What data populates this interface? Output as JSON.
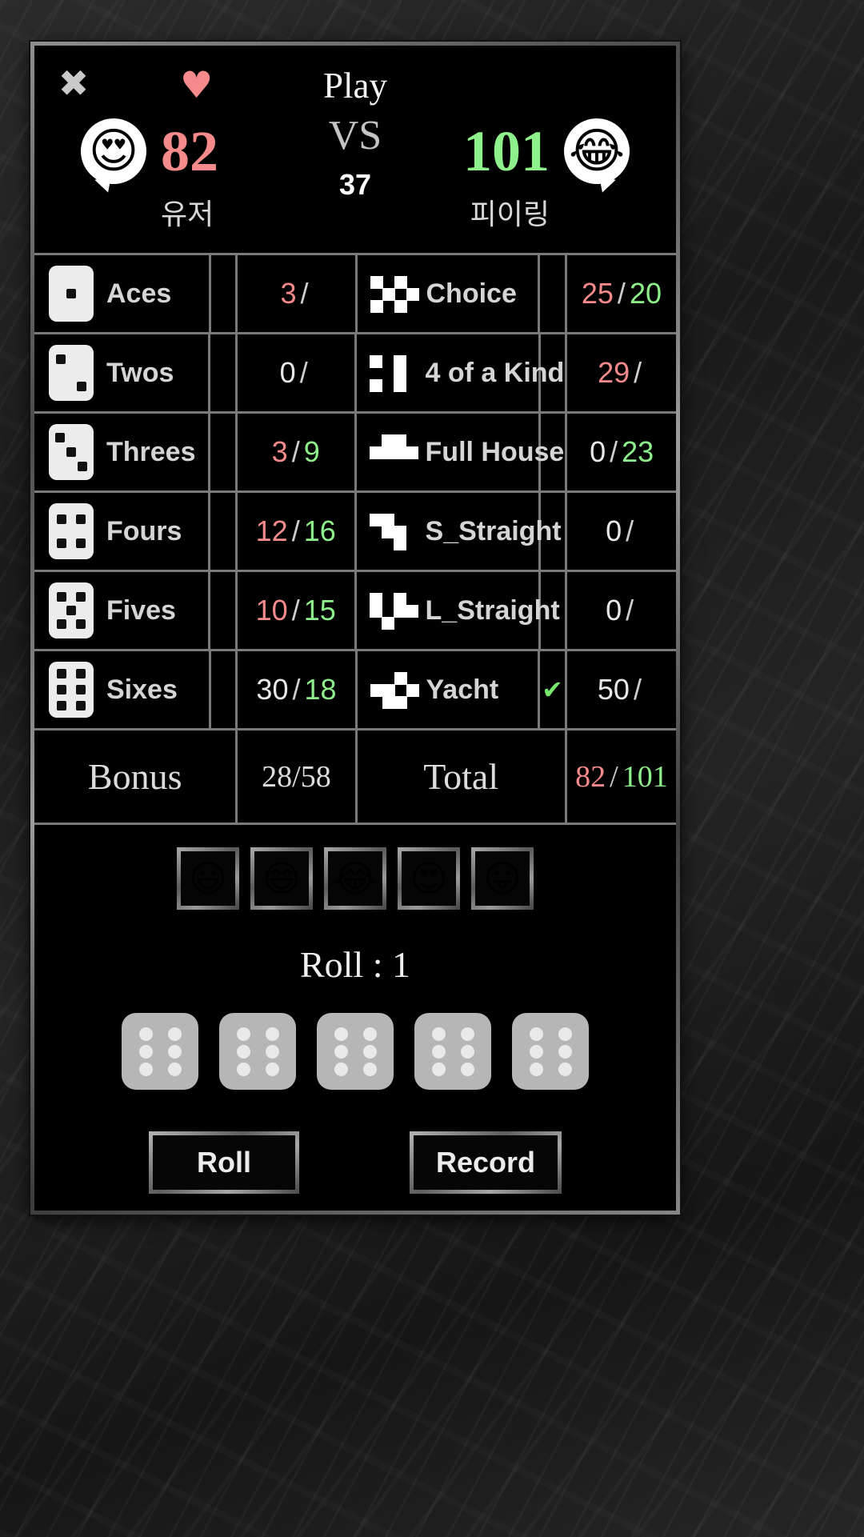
{
  "header": {
    "close_icon": "✖",
    "turn_heart_icon": "♥",
    "play_label": "Play",
    "vs_label": "VS",
    "turn_count": "37",
    "left_player": {
      "avatar_emoji": "😍",
      "score": "82",
      "name": "유저",
      "color": "#f58a8a"
    },
    "right_player": {
      "avatar_emoji": "😂",
      "score": "101",
      "name": "피이링",
      "color": "#8ef08a"
    }
  },
  "table": {
    "rows": [
      {
        "left": {
          "label": "Aces",
          "icon": "die-1",
          "score_a": "3",
          "score_b": "",
          "a_color": "red",
          "b_color": "green",
          "checked": false
        },
        "right": {
          "label": "Choice",
          "icon": "pix-choice",
          "score_a": "25",
          "score_b": "20",
          "a_color": "red",
          "b_color": "green",
          "checked": false
        }
      },
      {
        "left": {
          "label": "Twos",
          "icon": "die-2",
          "score_a": "0",
          "score_b": "",
          "a_color": "white",
          "b_color": "green",
          "checked": false
        },
        "right": {
          "label": "4 of a Kind",
          "icon": "pix-four",
          "score_a": "29",
          "score_b": "",
          "a_color": "red",
          "b_color": "green",
          "checked": false
        }
      },
      {
        "left": {
          "label": "Threes",
          "icon": "die-3",
          "score_a": "3",
          "score_b": "9",
          "a_color": "red",
          "b_color": "green",
          "checked": false
        },
        "right": {
          "label": "Full House",
          "icon": "pix-fullhouse",
          "score_a": "0",
          "score_b": "23",
          "a_color": "white",
          "b_color": "green",
          "checked": false
        }
      },
      {
        "left": {
          "label": "Fours",
          "icon": "die-4",
          "score_a": "12",
          "score_b": "16",
          "a_color": "red",
          "b_color": "green",
          "checked": false
        },
        "right": {
          "label": "S_Straight",
          "icon": "pix-sstraight",
          "score_a": "0",
          "score_b": "",
          "a_color": "white",
          "b_color": "green",
          "checked": false
        }
      },
      {
        "left": {
          "label": "Fives",
          "icon": "die-5",
          "score_a": "10",
          "score_b": "15",
          "a_color": "red",
          "b_color": "green",
          "checked": false
        },
        "right": {
          "label": "L_Straight",
          "icon": "pix-lstraight",
          "score_a": "0",
          "score_b": "",
          "a_color": "white",
          "b_color": "green",
          "checked": false
        }
      },
      {
        "left": {
          "label": "Sixes",
          "icon": "die-6",
          "score_a": "30",
          "score_b": "18",
          "a_color": "white",
          "b_color": "green",
          "checked": false
        },
        "right": {
          "label": "Yacht",
          "icon": "pix-yacht",
          "score_a": "50",
          "score_b": "",
          "a_color": "white",
          "b_color": "green",
          "checked": true,
          "check_icon": "✔"
        }
      }
    ],
    "bonus": {
      "label": "Bonus",
      "value": "28/58"
    },
    "total": {
      "label": "Total",
      "score_a": "82",
      "score_b": "101",
      "a_color": "red",
      "b_color": "green"
    },
    "slash": "/"
  },
  "bottom": {
    "emojis": [
      "😃",
      "😄",
      "😂",
      "😍",
      "😛"
    ],
    "emoji_names": [
      "emoji-grinning",
      "emoji-smiling-eyes",
      "emoji-tears-of-joy",
      "emoji-heart-eyes",
      "emoji-tongue-out"
    ],
    "roll_label": "Roll : 1",
    "dice": [
      {
        "value": 6
      },
      {
        "value": 6
      },
      {
        "value": 6
      },
      {
        "value": 6
      },
      {
        "value": 6
      }
    ],
    "roll_button": "Roll",
    "record_button": "Record"
  },
  "colors": {
    "red": "#f58a8a",
    "green": "#8ef08a",
    "white": "#e8e8e8",
    "border": "#7a7a7a",
    "background": "#000000"
  }
}
